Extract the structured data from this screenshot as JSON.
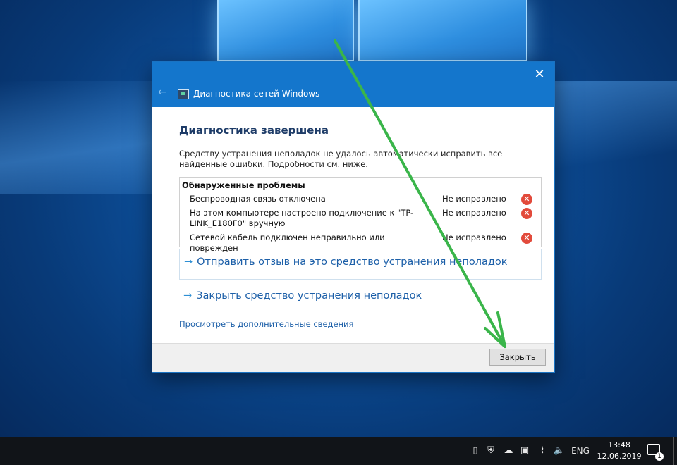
{
  "window": {
    "title": "Диагностика сетей Windows",
    "close_glyph": "✕",
    "back_glyph": "←"
  },
  "main": {
    "heading": "Диагностика завершена",
    "description": "Средству устранения неполадок не удалось автоматически исправить все найденные ошибки. Подробности см. ниже.",
    "problems_header": "Обнаруженные проблемы",
    "problems": [
      {
        "text": "Беспроводная связь отключена",
        "status": "Не исправлено"
      },
      {
        "text": "На этом компьютере настроено подключение к \"TP-LINK_E180F0\" вручную",
        "status": "Не исправлено"
      },
      {
        "text": "Сетевой кабель подключен неправильно или поврежден",
        "status": "Не исправлено"
      }
    ],
    "send_feedback_link": "Отправить отзыв на это средство устранения неполадок",
    "close_troubleshooter_link": "Закрыть средство устранения неполадок",
    "more_info_link": "Просмотреть дополнительные сведения",
    "arrow_glyph": "→",
    "error_glyph": "✕"
  },
  "footer": {
    "close_button": "Закрыть"
  },
  "taskbar": {
    "language": "ENG",
    "time": "13:48",
    "date": "12.06.2019",
    "notification_count": "1"
  },
  "colors": {
    "titlebar": "#1476cc",
    "link": "#1c5fa8",
    "annotation_arrow": "#3ab54a",
    "error": "#e24a3b"
  }
}
